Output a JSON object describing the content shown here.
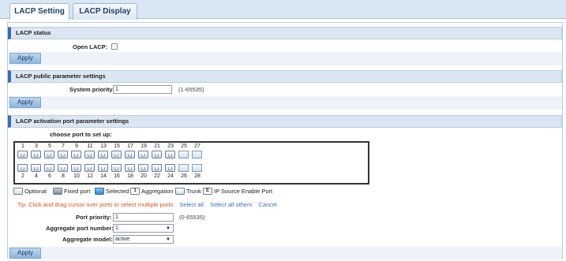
{
  "tabs": [
    {
      "label": "LACP Setting",
      "active": true
    },
    {
      "label": "LACP Display",
      "active": false
    }
  ],
  "lacp_status": {
    "title": "LACP status",
    "open_label": "Open LACP:",
    "open_checked": false,
    "apply": "Apply"
  },
  "public_params": {
    "title": "LACP public parameter settings",
    "priority_label": "System priority",
    "priority_value": "1",
    "priority_range": "(1-65535)",
    "apply": "Apply"
  },
  "activation": {
    "title": "LACP activation port parameter settings",
    "choose_label": "choose port to set up:",
    "top_ports": [
      "1",
      "3",
      "5",
      "7",
      "9",
      "11",
      "13",
      "15",
      "17",
      "19",
      "21",
      "23",
      "25",
      "27"
    ],
    "bottom_ports": [
      "2",
      "4",
      "6",
      "8",
      "10",
      "12",
      "14",
      "16",
      "18",
      "20",
      "22",
      "24",
      "26",
      "28"
    ],
    "legend": {
      "optional": "Optional",
      "fixed": "Fixed port",
      "selected": "Selected",
      "aggregation": "Aggregation",
      "trunk": "Trunk",
      "ipsource": "IP Source Enable Port",
      "aggregation_badge": "1",
      "ipsource_badge": "E"
    },
    "tip_prefix": "Tip:",
    "tip_text": "Click and drag cursor over ports to select multiple ports",
    "select_all": "Select all",
    "select_all_others": "Select all others",
    "cancel": "Cancel",
    "port_priority_label": "Port priority:",
    "port_priority_value": "1",
    "port_priority_range": "(0-65535)",
    "agg_number_label": "Aggregate port number:",
    "agg_number_value": "1",
    "agg_model_label": "Aggregate model:",
    "agg_model_value": "active",
    "apply": "Apply"
  },
  "colors": {
    "header_bg": "#dbe6f2",
    "accent": "#3a6ea8",
    "tip": "#d9531e",
    "link": "#3a6fb0"
  }
}
